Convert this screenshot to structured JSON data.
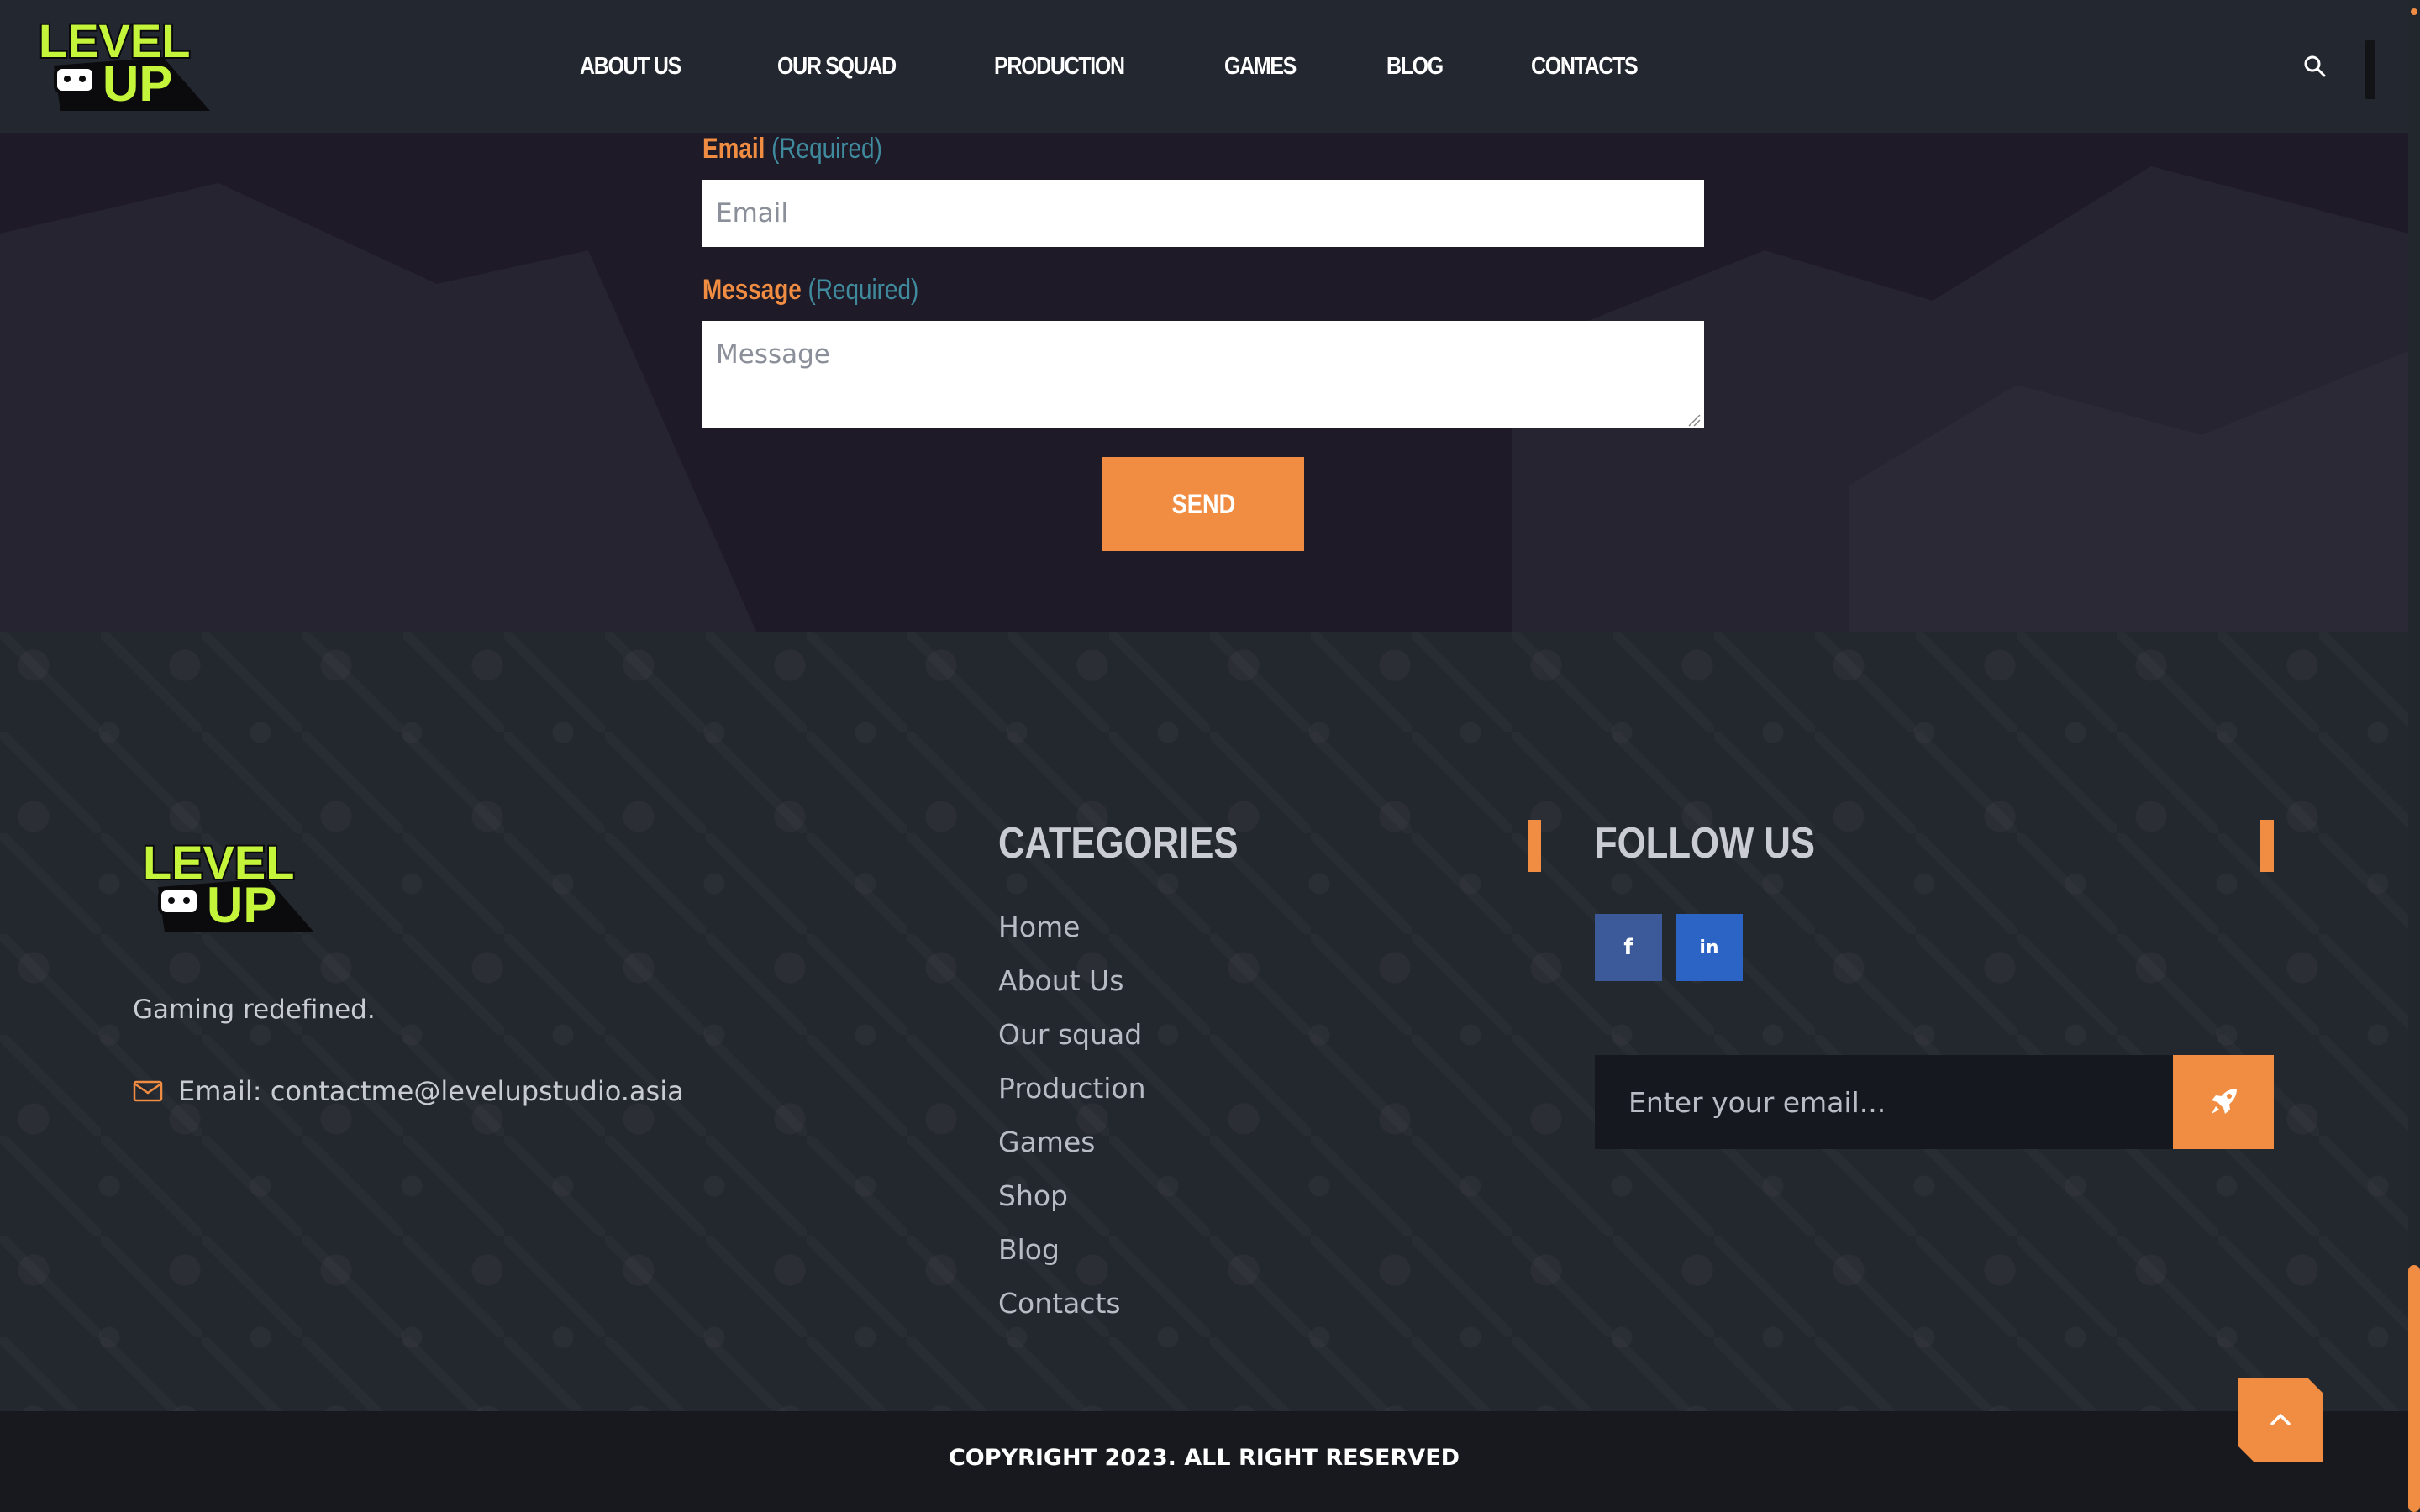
{
  "brand": {
    "logo_text": "LEVEL UP",
    "accent_color": "#f18d42",
    "logo_color": "#c5f53a"
  },
  "header": {
    "nav": [
      "ABOUT US",
      "OUR SQUAD",
      "PRODUCTION",
      "GAMES",
      "BLOG",
      "CONTACTS"
    ],
    "search_icon": "search-icon"
  },
  "contact_form": {
    "email_label": "Email",
    "email_required": "(Required)",
    "email_placeholder": "Email",
    "message_label": "Message",
    "message_required": "(Required)",
    "message_placeholder": "Message",
    "send_label": "SEND"
  },
  "footer": {
    "tagline": "Gaming redefined.",
    "email": "Email: contactme@levelupstudio.asia",
    "categories_title": "CATEGORIES",
    "categories": [
      "Home",
      "About Us",
      "Our squad",
      "Production",
      "Games",
      "Shop",
      "Blog",
      "Contacts"
    ],
    "follow_title": "FOLLOW US",
    "social": {
      "facebook": "f",
      "linkedin": "in"
    },
    "newsletter_placeholder": "Enter your email..."
  },
  "copyright": "COPYRIGHT 2023. ALL RIGHT RESERVED"
}
